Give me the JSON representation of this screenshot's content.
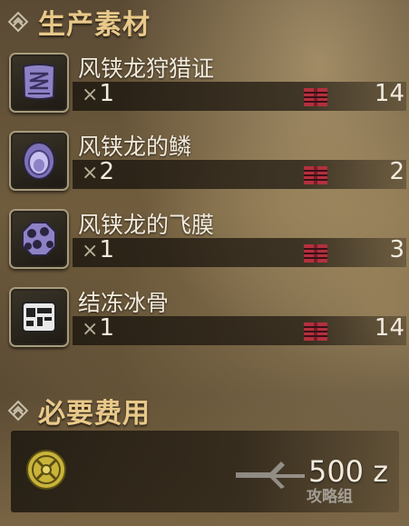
{
  "sections": {
    "materials_title": "生产素材",
    "cost_title": "必要费用"
  },
  "items": [
    {
      "name": "风铗龙狩猎证",
      "x_symbol": "×",
      "qty": "1",
      "owned": "14",
      "icon": "hunting-certificate-icon"
    },
    {
      "name": "风铗龙的鳞",
      "x_symbol": "×",
      "qty": "2",
      "owned": "2",
      "icon": "scale-icon"
    },
    {
      "name": "风铗龙的飞膜",
      "x_symbol": "×",
      "qty": "1",
      "owned": "3",
      "icon": "wing-membrane-icon"
    },
    {
      "name": "结冻冰骨",
      "x_symbol": "×",
      "qty": "1",
      "owned": "14",
      "icon": "frozen-bone-icon"
    }
  ],
  "cost": {
    "value": "500",
    "unit": "z"
  },
  "watermark": {
    "text": "攻略组"
  },
  "colors": {
    "header": "#e9c98a",
    "purple": "#8e82c6",
    "box_red": "#b3303e"
  }
}
